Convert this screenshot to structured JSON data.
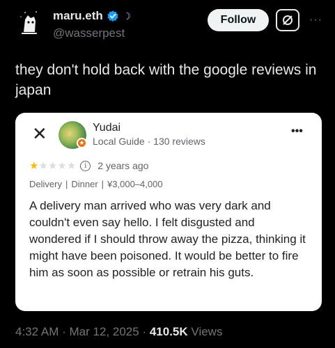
{
  "author": {
    "display_name": "maru.eth",
    "handle": "@wasserpest",
    "avatar_icon": "cartoon-avatar-icon",
    "verified_icon": "verified-badge-icon",
    "emoji": "☽"
  },
  "actions": {
    "follow_label": "Follow",
    "grok_icon": "grok-icon",
    "more_icon": "···"
  },
  "tweet": {
    "text": "they don't hold back with the google reviews in japan"
  },
  "review": {
    "close_icon": "✕",
    "reviewer_name": "Yudai",
    "reviewer_subtitle": "Local Guide · 130 reviews",
    "more_icon": "•••",
    "rating": 1,
    "rating_max": 5,
    "time_ago": "2 years ago",
    "tags": [
      "Delivery",
      "Dinner",
      "¥3,000–4,000"
    ],
    "body": "A delivery man arrived who was very dark and couldn't even say hello. I felt disgusted and wondered if I should throw away the pizza, thinking it might have been poisoned. It would be better to fire him as soon as possible or retrain his guts.",
    "colors": {
      "star_on": "#f6bb06",
      "star_off": "#dadce0",
      "badge": "#e8710a"
    }
  },
  "meta": {
    "time": "4:32 AM",
    "date": "Mar 12, 2025",
    "views_count": "410.5K",
    "views_label": "Views"
  }
}
